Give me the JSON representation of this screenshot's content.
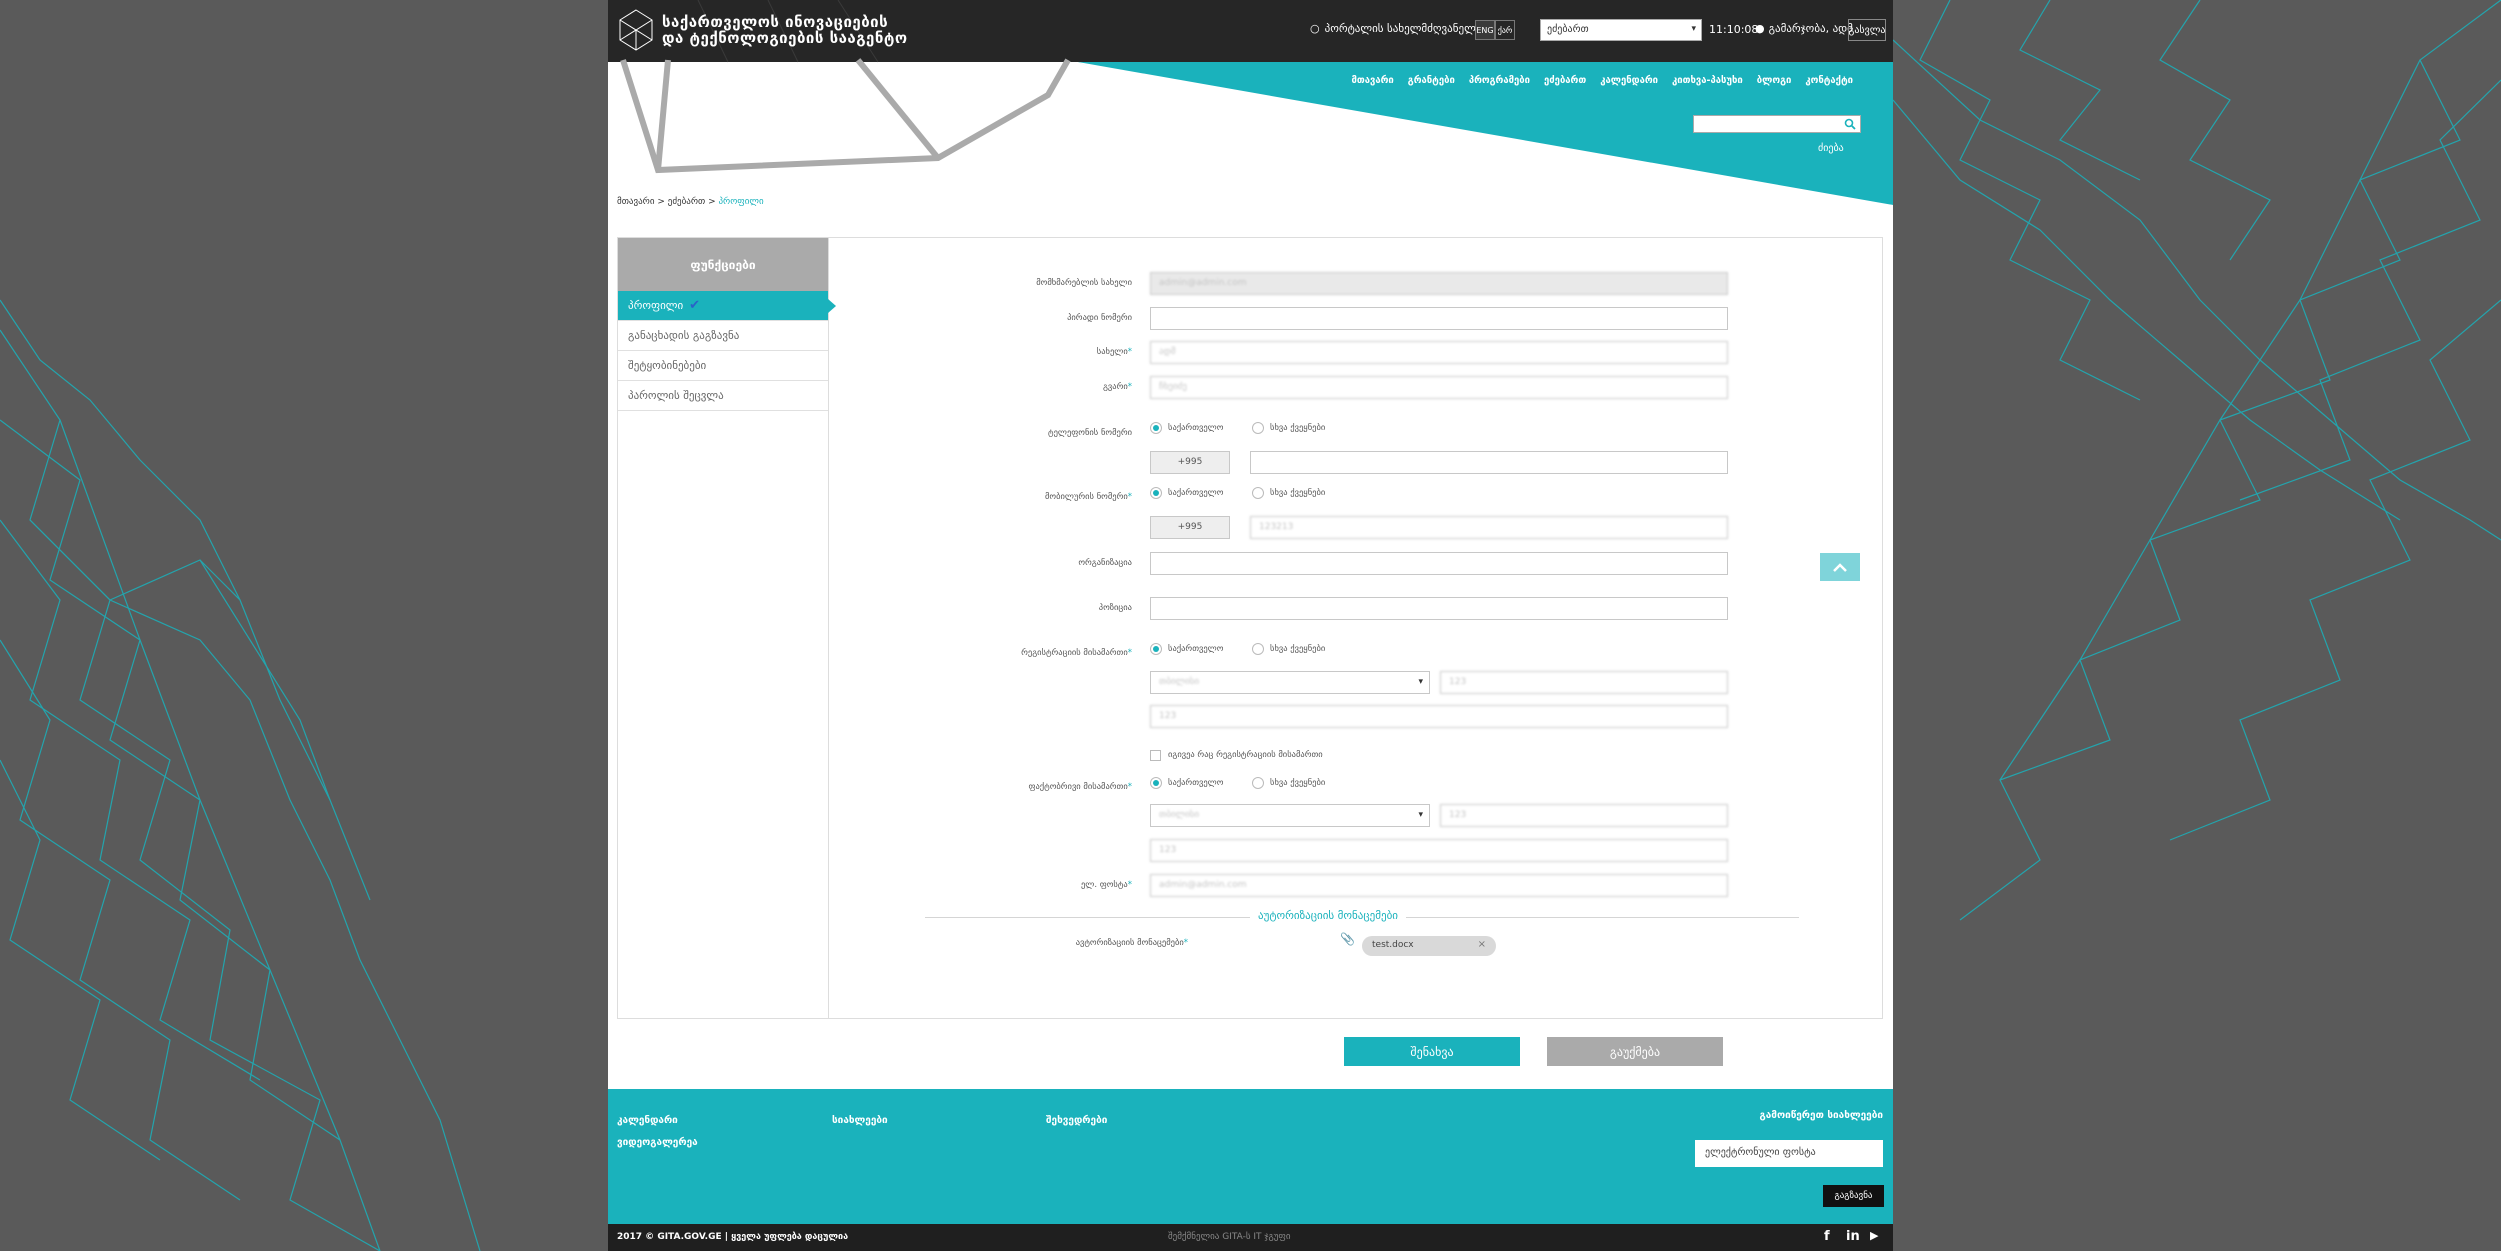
{
  "header": {
    "logo_line1": "საქართველოს ინოვაციების",
    "logo_line2": "და ტექნოლოგიების სააგენტო",
    "portal_link": "პორტალის სახელმძღვანელო",
    "lang_eng": "ENG",
    "lang_geo": "ქარ",
    "select_value": "ეძებართ",
    "clock": "11:10:08",
    "user_name": "გამარჯობა, ადმ",
    "logout": "გასვლა",
    "nav": [
      "მთავარი",
      "გრანტები",
      "პროგრამები",
      "ეძებართ",
      "კალენდარი",
      "კითხვა-პასუხი",
      "ბლოგი",
      "კონტაქტი"
    ],
    "search_label": "ძიება"
  },
  "breadcrumb": {
    "home": "მთავარი",
    "sep": " > ",
    "section": "ეძებართ",
    "current": "პროფილი"
  },
  "sidebar": {
    "title": "ფუნქციები",
    "items": [
      {
        "label": "პროფილი"
      },
      {
        "label": "განაცხადის გაგზავნა"
      },
      {
        "label": "შეტყობინებები"
      },
      {
        "label": "პაროლის შეცვლა"
      }
    ]
  },
  "form": {
    "username_label": "მომხმარებლის სახელი",
    "username_value": "admin@admin.com",
    "personal_id_label": "პირადი ნომერი",
    "first_name_label": "სახელი",
    "first_name_value": "ადმ",
    "last_name_label": "გვარი",
    "last_name_value": "ჩხეიძე",
    "phone_label": "ტელეფონის ნომერი",
    "mobile_label": "მობილურის ნომერი",
    "radio_georgia": "საქართველო",
    "radio_other": "სხვა ქვეყნები",
    "phone_prefix": "+995",
    "mobile_prefix": "+995",
    "mobile_value": "123213",
    "organization_label": "ორგანიზაცია",
    "position_label": "პოზიცია",
    "legal_address_label": "რეგისტრაციის მისამართი",
    "legal_city": "თბილისი",
    "legal_zip": "123",
    "legal_street": "123",
    "same_address_label": "იგივეა რაც რეგისტრაციის მისამართი",
    "actual_address_label": "ფაქტობრივი მისამართი",
    "actual_city": "თბილისი",
    "actual_zip": "123",
    "actual_street": "123",
    "email_label": "ელ. ფოსტა",
    "email_value": "admin@admin.com",
    "required_mark": "*",
    "section_title": "აუტორიზაციის მონაცემები",
    "file_label": "ავტორიზაციის მონაცემები",
    "file_name": "test.docx",
    "save": "შენახვა",
    "cancel": "გაუქმება"
  },
  "footer": {
    "links": [
      "კალენდარი",
      "სიახლეები",
      "შეხვედრები",
      "ვიდეოგალერეა"
    ],
    "newsletter_title": "გამოიწერეთ სიახლეები",
    "newsletter_placeholder": "ელექტრონული ფოსტა",
    "subscribe": "გაგზავნა",
    "copyright": "2017 © GITA.GOV.GE | ყველა უფლება დაცულია",
    "dev_credit": "შემქმნელია GITA-ს IT ჯგუფი"
  },
  "colors": {
    "accent": "#1ab2bc",
    "dark": "#262626",
    "background": "#5a5a5a"
  }
}
